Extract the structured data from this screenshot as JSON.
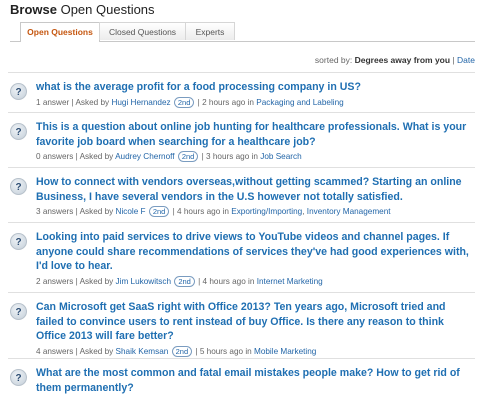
{
  "header": {
    "title_bold": "Browse",
    "title_rest": "Open Questions"
  },
  "tabs": [
    {
      "label": "Open Questions",
      "active": true
    },
    {
      "label": "Closed Questions",
      "active": false
    },
    {
      "label": "Experts",
      "active": false
    }
  ],
  "sort": {
    "label": "sorted by:",
    "value": "Degrees away from you",
    "separator": "|",
    "alt": "Date"
  },
  "questions": [
    {
      "title": "what is the average profit for a food processing company in US?",
      "answers": "1 answer",
      "asked_by": "Asked by",
      "author": "Hugi Hernandez",
      "degree": "2nd",
      "time": "2 hours ago in",
      "categories": [
        "Packaging and Labeling"
      ]
    },
    {
      "title": "This is a question about online job hunting for healthcare professionals. What is your favorite job board when searching for a healthcare job?",
      "answers": "0 answers",
      "asked_by": "Asked by",
      "author": "Audrey Chernoff",
      "degree": "2nd",
      "time": "3 hours ago in",
      "categories": [
        "Job Search"
      ]
    },
    {
      "title": "How to connect with vendors overseas,without getting scammed? Starting an online Business, I have several vendors in the U.S however not totally satisfied.",
      "answers": "3 answers",
      "asked_by": "Asked by",
      "author": "Nicole F",
      "degree": "2nd",
      "time": "4 hours ago in",
      "categories": [
        "Exporting/Importing",
        "Inventory Management"
      ]
    },
    {
      "title": "Looking into paid services to drive views to YouTube videos and channel pages. If anyone could share recommendations of services they've had good experiences with, I'd love to hear.",
      "answers": "2 answers",
      "asked_by": "Asked by",
      "author": "Jim Lukowitsch",
      "degree": "2nd",
      "time": "4 hours ago in",
      "categories": [
        "Internet Marketing"
      ]
    },
    {
      "title": "Can Microsoft get SaaS right with Office 2013? Ten years ago, Microsoft tried and failed to convince users to rent instead of buy Office. Is there any reason to think Office 2013 will fare better?",
      "answers": "4 answers",
      "asked_by": "Asked by",
      "author": "Shaik Kemsan",
      "degree": "2nd",
      "time": "5 hours ago in",
      "categories": [
        "Mobile Marketing"
      ]
    },
    {
      "title": "What are the most common and fatal email mistakes people make? How to get rid of them permanently?",
      "answers": "",
      "asked_by": "",
      "author": "",
      "degree": "",
      "time": "",
      "categories": []
    }
  ],
  "icons": {
    "question": "question-mark-icon"
  }
}
